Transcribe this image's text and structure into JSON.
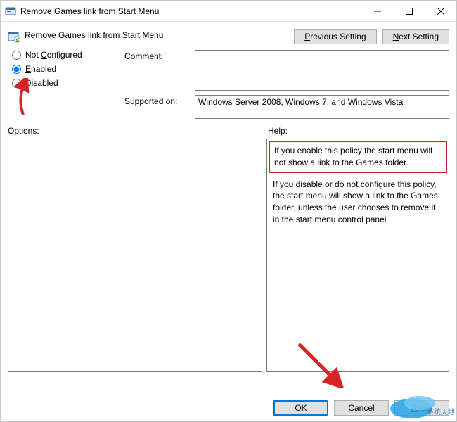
{
  "titlebar": {
    "title": "Remove Games link from Start Menu"
  },
  "header": {
    "setting_name": "Remove Games link from Start Menu",
    "previous": "Previous Setting",
    "next": "Next Setting"
  },
  "radios": {
    "not_configured": "Not Configured",
    "enabled": "Enabled",
    "disabled": "Disabled",
    "selected": "enabled"
  },
  "fields": {
    "comment_label": "Comment:",
    "comment_value": "",
    "supported_label": "Supported on:",
    "supported_value": "Windows Server 2008, Windows 7, and Windows Vista"
  },
  "panels": {
    "options_label": "Options:",
    "help_label": "Help:"
  },
  "help": {
    "p1": "If you enable this policy the start menu will not show a link to the Games folder.",
    "p2": "If you disable or do not configure this policy, the start menu will show a link to the Games folder, unless the user chooses to remove it in the start menu control panel."
  },
  "buttons": {
    "ok": "OK",
    "cancel": "Cancel",
    "apply": "Apply"
  },
  "accelerator_hints": {
    "previous": "P",
    "next": "N",
    "not_configured": "C",
    "enabled": "E",
    "disabled": "D",
    "apply": "A"
  }
}
